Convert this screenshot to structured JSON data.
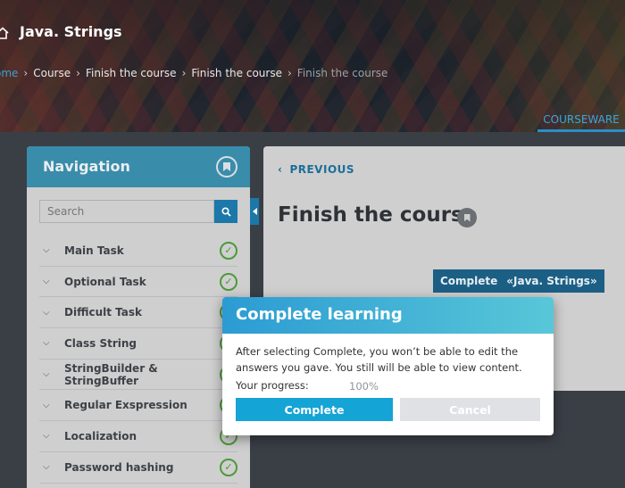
{
  "header": {
    "course_title": "Java. Strings",
    "breadcrumb": [
      "ome",
      "Course",
      "Finish the course",
      "Finish the course",
      "Finish the course"
    ],
    "tab_courseware": "COURSEWARE"
  },
  "sidebar": {
    "title": "Navigation",
    "search_placeholder": "Search",
    "items": [
      {
        "label": "Main Task",
        "completed": true
      },
      {
        "label": "Optional Task",
        "completed": true
      },
      {
        "label": "Difficult Task",
        "completed": true
      },
      {
        "label": "Class String",
        "completed": true
      },
      {
        "label": "StringBuilder & StringBuffer",
        "completed": true
      },
      {
        "label": "Regular Exspression",
        "completed": true
      },
      {
        "label": "Localization",
        "completed": true
      },
      {
        "label": "Password hashing",
        "completed": true
      }
    ]
  },
  "content": {
    "previous_label": "PREVIOUS",
    "unit_title": "Finish the course",
    "complete_button": "Complete",
    "complete_course_name": "«Java. Strings»"
  },
  "modal": {
    "title": "Complete learning",
    "message": "After selecting Complete, you won’t be able to edit the answers you gave. You still will be able to view content.",
    "progress_label": "Your progress:",
    "progress_value": "100%",
    "complete_label": "Complete",
    "cancel_label": "Cancel"
  },
  "colors": {
    "accent": "#15a4d6",
    "nav_header": "#3a8cab",
    "check": "#4c9a3a"
  }
}
